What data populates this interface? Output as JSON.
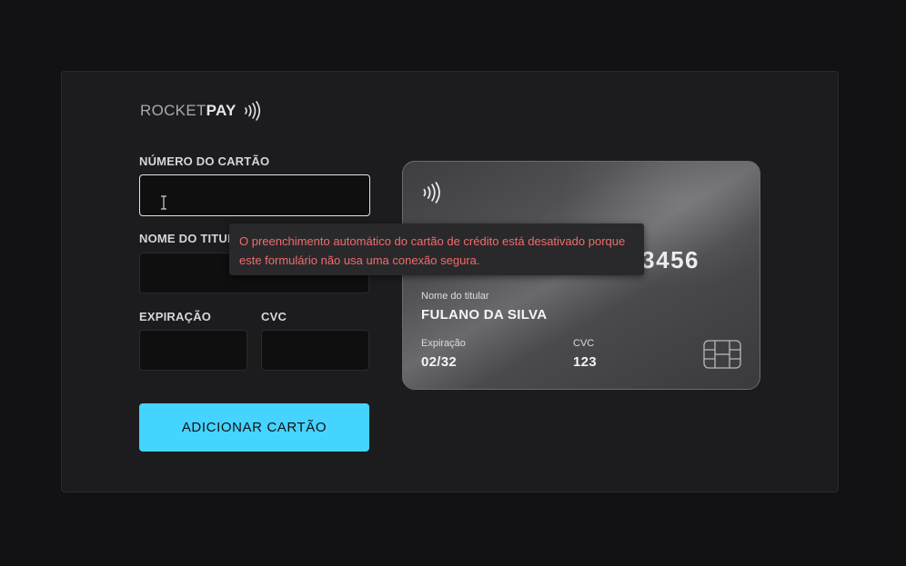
{
  "brand": {
    "name_light": "ROCKET",
    "name_bold": "PAY",
    "icon": "contactless-icon"
  },
  "form": {
    "card_number": {
      "label": "NÚMERO DO CARTÃO",
      "value": ""
    },
    "holder_name": {
      "label": "NOME DO TITULAR",
      "value": ""
    },
    "expiration": {
      "label": "EXPIRAÇÃO",
      "value": ""
    },
    "cvc": {
      "label": "CVC",
      "value": ""
    },
    "submit_label": "ADICIONAR CARTÃO"
  },
  "autofill_warning": "O preenchimento automático do cartão de crédito está desativado porque este formulário não usa uma conexão segura.",
  "card_preview": {
    "number": "1234 5678 9012 3456",
    "holder_label": "Nome do titular",
    "holder_value": "FULANO DA SILVA",
    "expiration_label": "Expiração",
    "expiration_value": "02/32",
    "cvc_label": "CVC",
    "cvc_value": "123",
    "icons": [
      "contactless-icon",
      "chip-icon"
    ]
  },
  "colors": {
    "accent": "#45d4ff",
    "warning_text": "#f26b6b",
    "background": "#121214",
    "panel": "#1c1c1f"
  }
}
